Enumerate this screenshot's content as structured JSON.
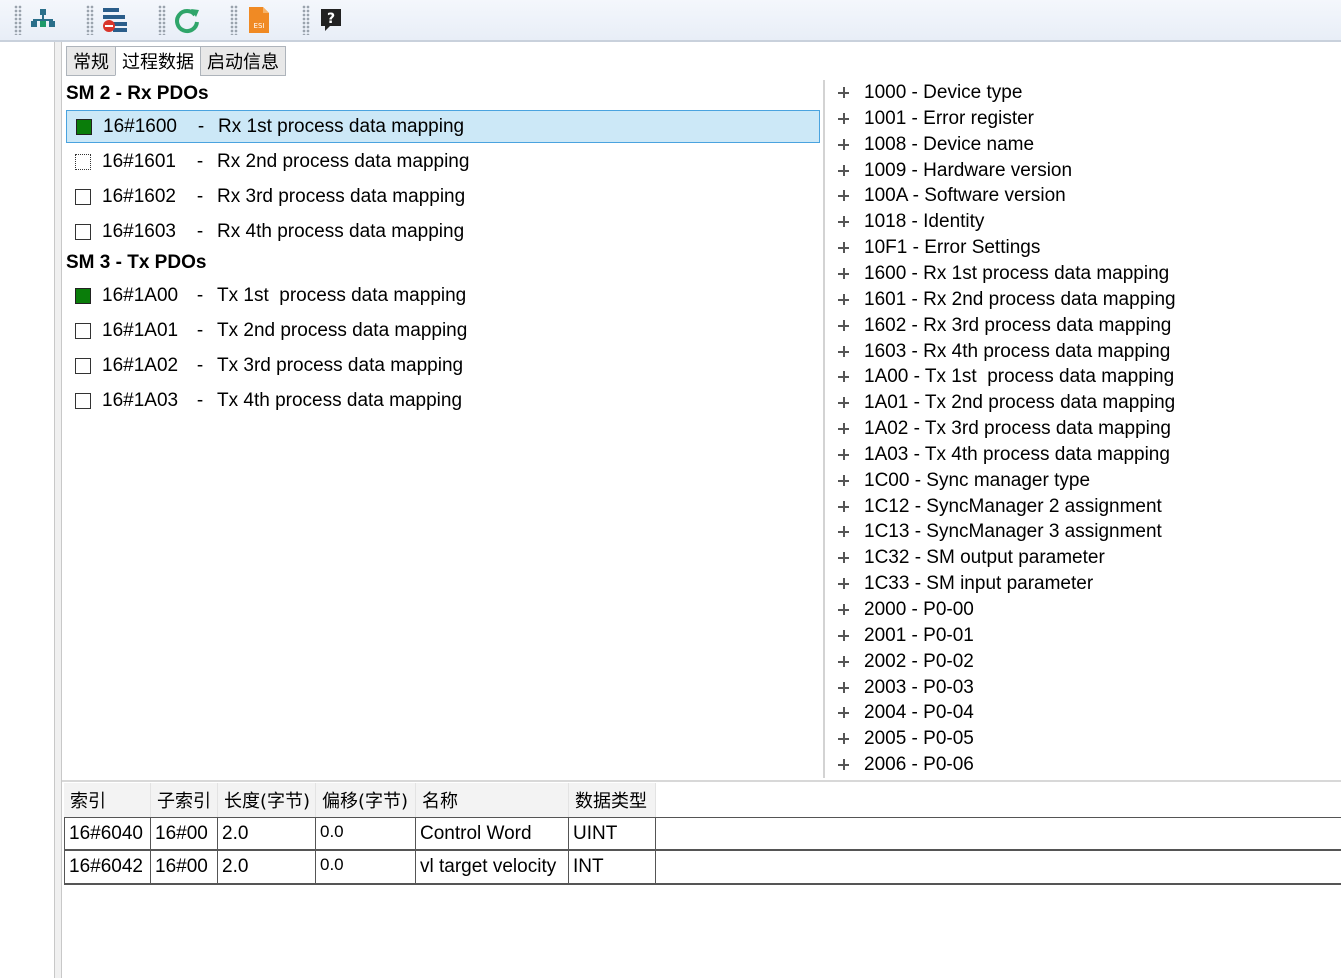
{
  "toolbar": {
    "buttons": [
      {
        "name": "network-tree-icon"
      },
      {
        "name": "device-config-icon"
      },
      {
        "name": "refresh-icon"
      },
      {
        "name": "esi-file-icon",
        "label": "ESI"
      },
      {
        "name": "help-icon",
        "label": "?"
      }
    ]
  },
  "tabs": [
    {
      "label": "常规"
    },
    {
      "label": "过程数据"
    },
    {
      "label": "启动信息"
    }
  ],
  "sm2": {
    "title": "SM 2 - Rx PDOs",
    "rows": [
      {
        "index": "16#1600",
        "name": "Rx 1st process data mapping",
        "state": "checked"
      },
      {
        "index": "16#1601",
        "name": "Rx 2nd process data mapping",
        "state": "dotted"
      },
      {
        "index": "16#1602",
        "name": "Rx 3rd process data mapping",
        "state": "unchecked"
      },
      {
        "index": "16#1603",
        "name": "Rx 4th process data mapping",
        "state": "unchecked"
      }
    ]
  },
  "sm3": {
    "title": "SM 3 - Tx PDOs",
    "rows": [
      {
        "index": "16#1A00",
        "name": "Tx 1st  process data mapping",
        "state": "checked"
      },
      {
        "index": "16#1A01",
        "name": "Tx 2nd process data mapping",
        "state": "unchecked"
      },
      {
        "index": "16#1A02",
        "name": "Tx 3rd process data mapping",
        "state": "unchecked"
      },
      {
        "index": "16#1A03",
        "name": "Tx 4th process data mapping",
        "state": "unchecked"
      }
    ]
  },
  "pdo_separator": "-",
  "objects": [
    "1000 - Device type",
    "1001 - Error register",
    "1008 - Device name",
    "1009 - Hardware version",
    "100A - Software version",
    "1018 - Identity",
    "10F1 - Error Settings",
    "1600 - Rx 1st process data mapping",
    "1601 - Rx 2nd process data mapping",
    "1602 - Rx 3rd process data mapping",
    "1603 - Rx 4th process data mapping",
    "1A00 - Tx 1st  process data mapping",
    "1A01 - Tx 2nd process data mapping",
    "1A02 - Tx 3rd process data mapping",
    "1A03 - Tx 4th process data mapping",
    "1C00 - Sync manager type",
    "1C12 - SyncManager 2 assignment",
    "1C13 - SyncManager 3 assignment",
    "1C32 - SM output parameter",
    "1C33 - SM input parameter",
    "2000 - P0-00",
    "2001 - P0-01",
    "2002 - P0-02",
    "2003 - P0-03",
    "2004 - P0-04",
    "2005 - P0-05",
    "2006 - P0-06"
  ],
  "table": {
    "headers": [
      "索引",
      "子索引",
      "长度(字节)",
      "偏移(字节)",
      "名称",
      "数据类型"
    ],
    "rows": [
      [
        "16#6040",
        "16#00",
        "2.0",
        "0.0",
        "Control Word",
        "UINT"
      ],
      [
        "16#6042",
        "16#00",
        "2.0",
        "0.0",
        "vl target velocity",
        "INT"
      ]
    ]
  }
}
